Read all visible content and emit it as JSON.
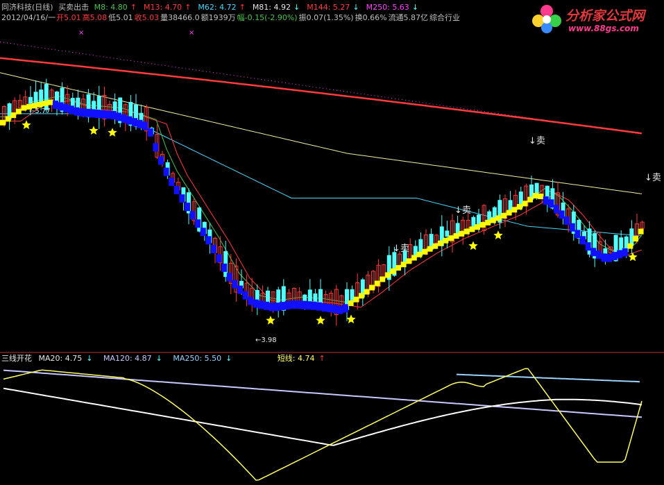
{
  "header1": {
    "title": "同济科技(日线)",
    "formula": "买卖出击",
    "ma": [
      {
        "label": "M8: 4.80",
        "arrow": "↑",
        "color": "#4cc44c"
      },
      {
        "label": "M13: 4.70",
        "arrow": "↑",
        "color": "#ff3b3b"
      },
      {
        "label": "M62: 4.72",
        "arrow": "↑",
        "color": "#48d8ff"
      },
      {
        "label": "M81: 4.92",
        "arrow": "↓",
        "color": "#e8e8e8"
      },
      {
        "label": "M144: 5.27",
        "arrow": "↓",
        "color": "#ff3b3b"
      },
      {
        "label": "M250: 5.63",
        "arrow": "↓",
        "color": "#ff44ff"
      }
    ]
  },
  "header2": {
    "date": "2012/04/16/一",
    "open": "开5.01",
    "high": "高5.08",
    "low": "低5.01",
    "close": "收5.03",
    "volume": "量38466.0",
    "amount": "额1939万",
    "change": "幅-0.15(-2.90%)",
    "amplitude": "振0.07(1.35%)",
    "turnover": "换0.66%",
    "float": "流通5.87亿",
    "industry": "综合行业"
  },
  "indicator": {
    "name": "三线开花",
    "ma20": {
      "label": "MA20: 4.75",
      "arrow": "↓"
    },
    "ma120": {
      "label": "MA120: 4.87",
      "arrow": "↓"
    },
    "ma250": {
      "label": "MA250: 5.50",
      "arrow": "↓"
    },
    "short": {
      "label": "短线: 4.74",
      "arrow": "↑"
    }
  },
  "annotations": {
    "sell": "卖",
    "high_label": "5.77",
    "low_label": "3.98"
  },
  "logo": {
    "title": "分析家公式网",
    "url": "www.88gs.com"
  },
  "colors": {
    "up": "#ff3b3b",
    "down": "#54ffff",
    "m8": "#4cc44c",
    "m13": "#ff3b3b",
    "m62": "#48d8ff",
    "m81": "#e8e8e8",
    "m144": "#ff3b3b",
    "m250": "#ff44ff",
    "buy_block": "#ffff00",
    "sell_block": "#1010ff"
  },
  "chart_data": {
    "type": "candlestick",
    "series": [
      {
        "name": "M250",
        "values": [
          5.63
        ]
      },
      {
        "name": "M144",
        "values": [
          5.27
        ]
      },
      {
        "name": "M81",
        "values": [
          4.92
        ]
      },
      {
        "name": "M62",
        "values": [
          4.72
        ]
      },
      {
        "name": "M13",
        "values": [
          4.7
        ]
      },
      {
        "name": "M8",
        "values": [
          4.8
        ]
      }
    ],
    "last_bar": {
      "date": "2012/04/16",
      "open": 5.01,
      "high": 5.08,
      "low": 5.01,
      "close": 5.03
    },
    "period_high": 5.77,
    "period_low": 3.98
  }
}
